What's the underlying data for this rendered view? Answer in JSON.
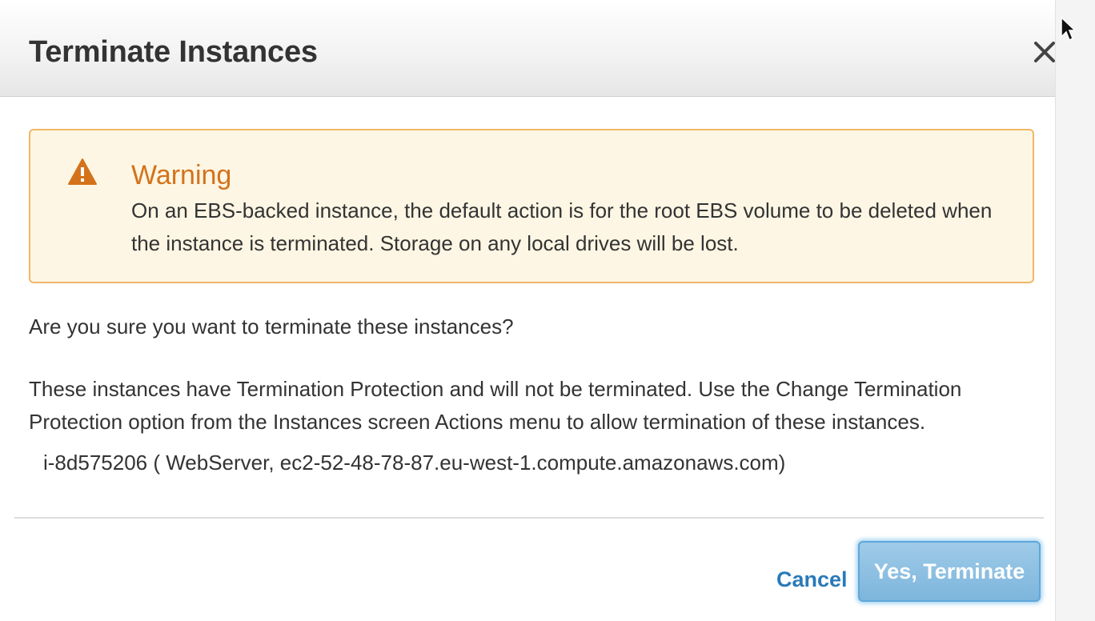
{
  "dialog": {
    "title": "Terminate Instances",
    "close_icon": "close-icon"
  },
  "warning": {
    "icon": "warning-triangle-icon",
    "title": "Warning",
    "text": "On an EBS-backed instance, the default action is for the root EBS volume to be deleted when the instance is terminated. Storage on any local drives will be lost.",
    "accent_color": "#d4721b",
    "border_color": "#f0b766",
    "background_color": "#fdf6e4"
  },
  "body": {
    "question": "Are you sure you want to terminate these instances?",
    "protection_text": "These instances have Termination Protection and will not be terminated. Use the Change Termination Protection option from the Instances screen Actions menu to allow termination of these instances.",
    "instance": "i-8d575206 ( WebServer, ec2-52-48-78-87.eu-west-1.compute.amazonaws.com)"
  },
  "footer": {
    "cancel_label": "Cancel",
    "confirm_label": "Yes, Terminate",
    "link_color": "#2a7ab8",
    "confirm_color": "#7db5dc"
  }
}
